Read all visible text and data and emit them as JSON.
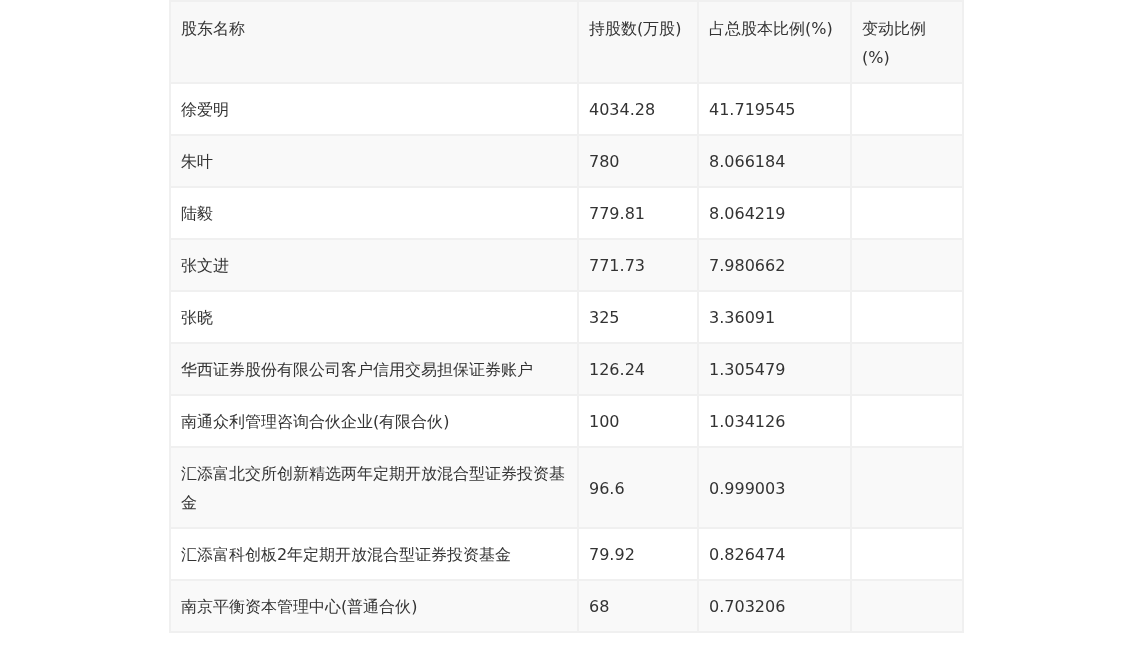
{
  "table": {
    "columns": [
      "股东名称",
      "持股数(万股)",
      "占总股本比例(%)",
      "变动比例(%)"
    ],
    "rows": [
      [
        "徐爱明",
        "4034.28",
        "41.719545",
        ""
      ],
      [
        "朱叶",
        "780",
        "8.066184",
        ""
      ],
      [
        "陆毅",
        "779.81",
        "8.064219",
        ""
      ],
      [
        "张文进",
        "771.73",
        "7.980662",
        ""
      ],
      [
        "张晓",
        "325",
        "3.36091",
        ""
      ],
      [
        "华西证券股份有限公司客户信用交易担保证券账户",
        "126.24",
        "1.305479",
        ""
      ],
      [
        "南通众利管理咨询合伙企业(有限合伙)",
        "100",
        "1.034126",
        ""
      ],
      [
        "汇添富北交所创新精选两年定期开放混合型证券投资基金",
        "96.6",
        "0.999003",
        ""
      ],
      [
        "汇添富科创板2年定期开放混合型证券投资基金",
        "79.92",
        "0.826474",
        ""
      ],
      [
        "南京平衡资本管理中心(普通合伙)",
        "68",
        "0.703206",
        ""
      ]
    ]
  }
}
